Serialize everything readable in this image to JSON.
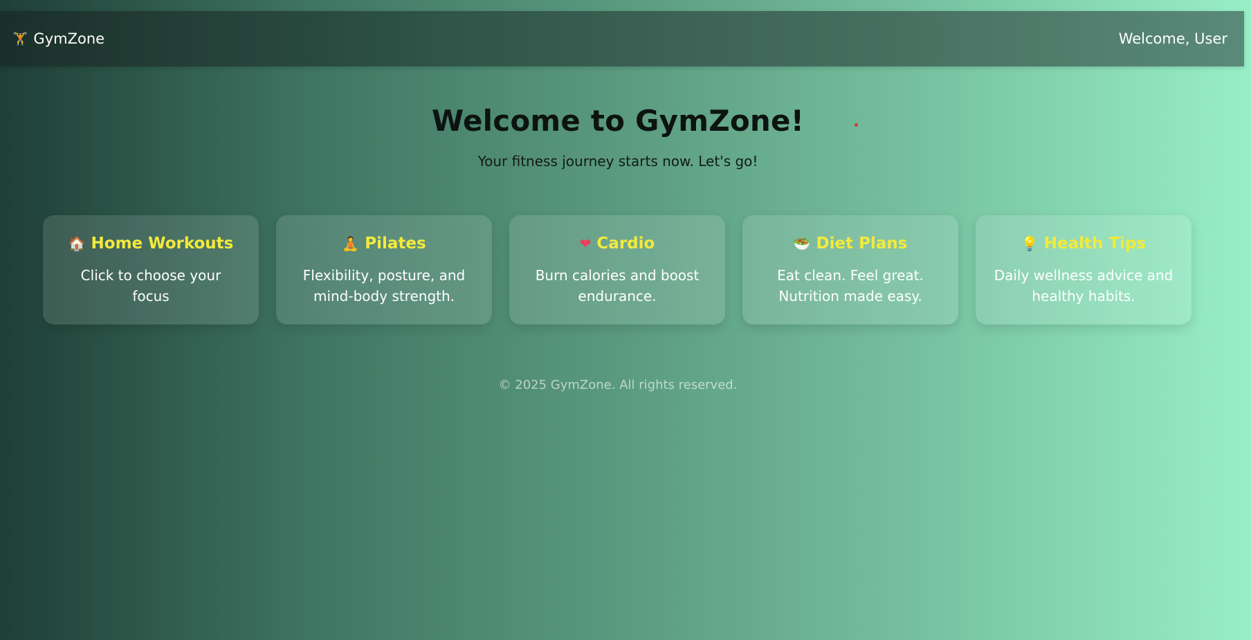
{
  "nav": {
    "brand_icon": "dumbbell-icon",
    "brand_glyph": "🏋",
    "brand": "GymZone",
    "welcome": "Welcome, User"
  },
  "hero": {
    "title": "Welcome to GymZone!",
    "subtitle": "Your fitness journey starts now. Let's go!"
  },
  "cards": [
    {
      "icon": "house-icon",
      "glyph": "🏠",
      "title": "Home Workouts",
      "desc": "Click to choose your focus"
    },
    {
      "icon": "meditation-icon",
      "glyph": "🧘",
      "title": "Pilates",
      "desc": "Flexibility, posture, and mind-body strength."
    },
    {
      "icon": "heart-icon",
      "glyph": "❤",
      "title": "Cardio",
      "desc": "Burn calories and boost endurance."
    },
    {
      "icon": "salad-bowl-icon",
      "glyph": "🥗",
      "title": "Diet Plans",
      "desc": "Eat clean. Feel great. Nutrition made easy."
    },
    {
      "icon": "lightbulb-icon",
      "glyph": "💡",
      "title": "Health Tips",
      "desc": "Daily wellness advice and healthy habits."
    }
  ],
  "footer": "© 2025 GymZone. All rights reserved.",
  "colors": {
    "card_title": "#f3ea3c",
    "heart": "#e8405b",
    "accent_dot": "#d43a2b"
  }
}
